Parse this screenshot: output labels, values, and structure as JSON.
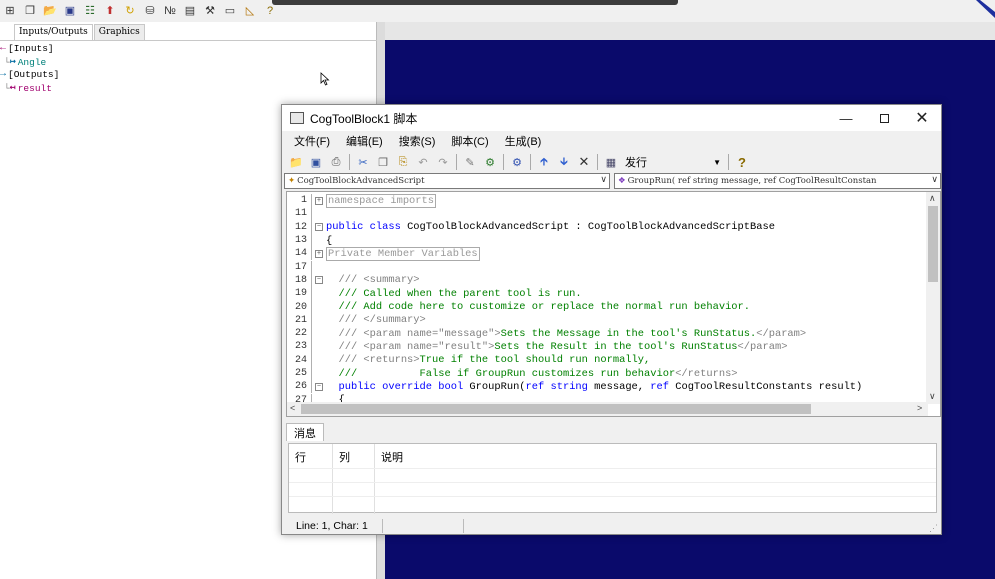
{
  "top_toolbar": {
    "icons": [
      "grid-icon",
      "copy-icon",
      "open-folder-icon",
      "save-icon",
      "network-icon",
      "upload-icon",
      "refresh-icon",
      "database-icon",
      "numeric-icon",
      "display-icon",
      "tools-icon",
      "terminal-icon",
      "measure-icon",
      "help-icon"
    ]
  },
  "left_pane": {
    "tabs": [
      "Inputs/Outputs",
      "Graphics"
    ],
    "tree": [
      {
        "text": "[Inputs]",
        "level": 0
      },
      {
        "text": "Angle",
        "level": 1
      },
      {
        "text": "[Outputs]",
        "level": 0
      },
      {
        "text": "result",
        "level": 1
      }
    ]
  },
  "dialog": {
    "title": "CogToolBlock1 脚本",
    "menu": [
      "文件(F)",
      "编辑(E)",
      "搜索(S)",
      "脚本(C)",
      "生成(B)"
    ],
    "build_mode": "发行",
    "left_combo": "CogToolBlockAdvancedScript",
    "right_combo": "GroupRun( ref string message,  ref CogToolResultConstan",
    "code": [
      {
        "ln": "1",
        "fold": "+",
        "parts": [
          {
            "c": "region",
            "t": "namespace imports"
          }
        ]
      },
      {
        "ln": "11",
        "fold": "",
        "parts": []
      },
      {
        "ln": "12",
        "fold": "-",
        "parts": [
          {
            "c": "kw",
            "t": "public class "
          },
          {
            "c": "txt",
            "t": "CogToolBlockAdvancedScript : CogToolBlockAdvancedScriptBase"
          }
        ]
      },
      {
        "ln": "13",
        "fold": "",
        "parts": [
          {
            "c": "txt",
            "t": "{"
          }
        ]
      },
      {
        "ln": "14",
        "fold": "+",
        "parts": [
          {
            "c": "region",
            "t": "Private Member Variables"
          }
        ]
      },
      {
        "ln": "17",
        "fold": "",
        "parts": []
      },
      {
        "ln": "18",
        "fold": "-",
        "parts": [
          {
            "c": "tag",
            "t": "  /// <summary>"
          }
        ]
      },
      {
        "ln": "19",
        "fold": "",
        "parts": [
          {
            "c": "cm",
            "t": "  /// Called when the parent tool is run."
          }
        ]
      },
      {
        "ln": "20",
        "fold": "",
        "parts": [
          {
            "c": "cm",
            "t": "  /// Add code here to customize or replace the normal run behavior."
          }
        ]
      },
      {
        "ln": "21",
        "fold": "",
        "parts": [
          {
            "c": "tag",
            "t": "  /// </summary>"
          }
        ]
      },
      {
        "ln": "22",
        "fold": "",
        "parts": [
          {
            "c": "tag",
            "t": "  /// <param name=\"message\">"
          },
          {
            "c": "cm",
            "t": "Sets the Message in the tool's RunStatus."
          },
          {
            "c": "tag",
            "t": "</param>"
          }
        ]
      },
      {
        "ln": "23",
        "fold": "",
        "parts": [
          {
            "c": "tag",
            "t": "  /// <param name=\"result\">"
          },
          {
            "c": "cm",
            "t": "Sets the Result in the tool's RunStatus"
          },
          {
            "c": "tag",
            "t": "</param>"
          }
        ]
      },
      {
        "ln": "24",
        "fold": "",
        "parts": [
          {
            "c": "tag",
            "t": "  /// <returns>"
          },
          {
            "c": "cm",
            "t": "True if the tool should run normally,"
          }
        ]
      },
      {
        "ln": "25",
        "fold": "",
        "parts": [
          {
            "c": "cm",
            "t": "  ///          False if GroupRun customizes run behavior"
          },
          {
            "c": "tag",
            "t": "</returns>"
          }
        ]
      },
      {
        "ln": "26",
        "fold": "-",
        "parts": [
          {
            "c": "kw",
            "t": "  public override bool "
          },
          {
            "c": "txt",
            "t": "GroupRun("
          },
          {
            "c": "kw",
            "t": "ref string "
          },
          {
            "c": "txt",
            "t": "message, "
          },
          {
            "c": "kw",
            "t": "ref "
          },
          {
            "c": "txt",
            "t": "CogToolResultConstants result)"
          }
        ]
      },
      {
        "ln": "27",
        "fold": "",
        "parts": [
          {
            "c": "txt",
            "t": "  {"
          }
        ]
      }
    ],
    "messages": {
      "tab": "消息",
      "columns": [
        "行",
        "列",
        "说明"
      ]
    },
    "status": "Line: 1, Char: 1"
  }
}
